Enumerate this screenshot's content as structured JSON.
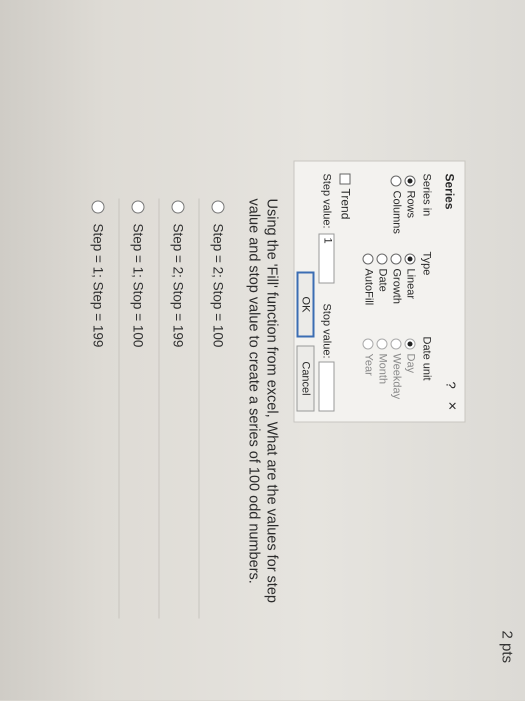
{
  "points": "2 pts",
  "dialog": {
    "title": "Series",
    "help": "?",
    "close": "×",
    "series_in_label": "Series in",
    "series_in_options": [
      "Rows",
      "Columns"
    ],
    "type_label": "Type",
    "type_options": [
      "Linear",
      "Growth",
      "Date",
      "AutoFill"
    ],
    "date_unit_label": "Date unit",
    "date_unit_options": [
      "Day",
      "Weekday",
      "Month",
      "Year"
    ],
    "trend_label": "Trend",
    "step_value_label": "Step value:",
    "step_value": "1",
    "stop_value_label": "Stop value:",
    "stop_value": "",
    "ok_label": "OK",
    "cancel_label": "Cancel"
  },
  "question": {
    "text": "Using the 'Fill' function from excel, What are the values for step value and stop value to create a series of 100 odd numbers."
  },
  "answers": [
    "Step = 2; Stop = 100",
    "Step = 2; Stop = 199",
    "Step = 1; Stop = 100",
    "Step = 1; Step = 199"
  ]
}
